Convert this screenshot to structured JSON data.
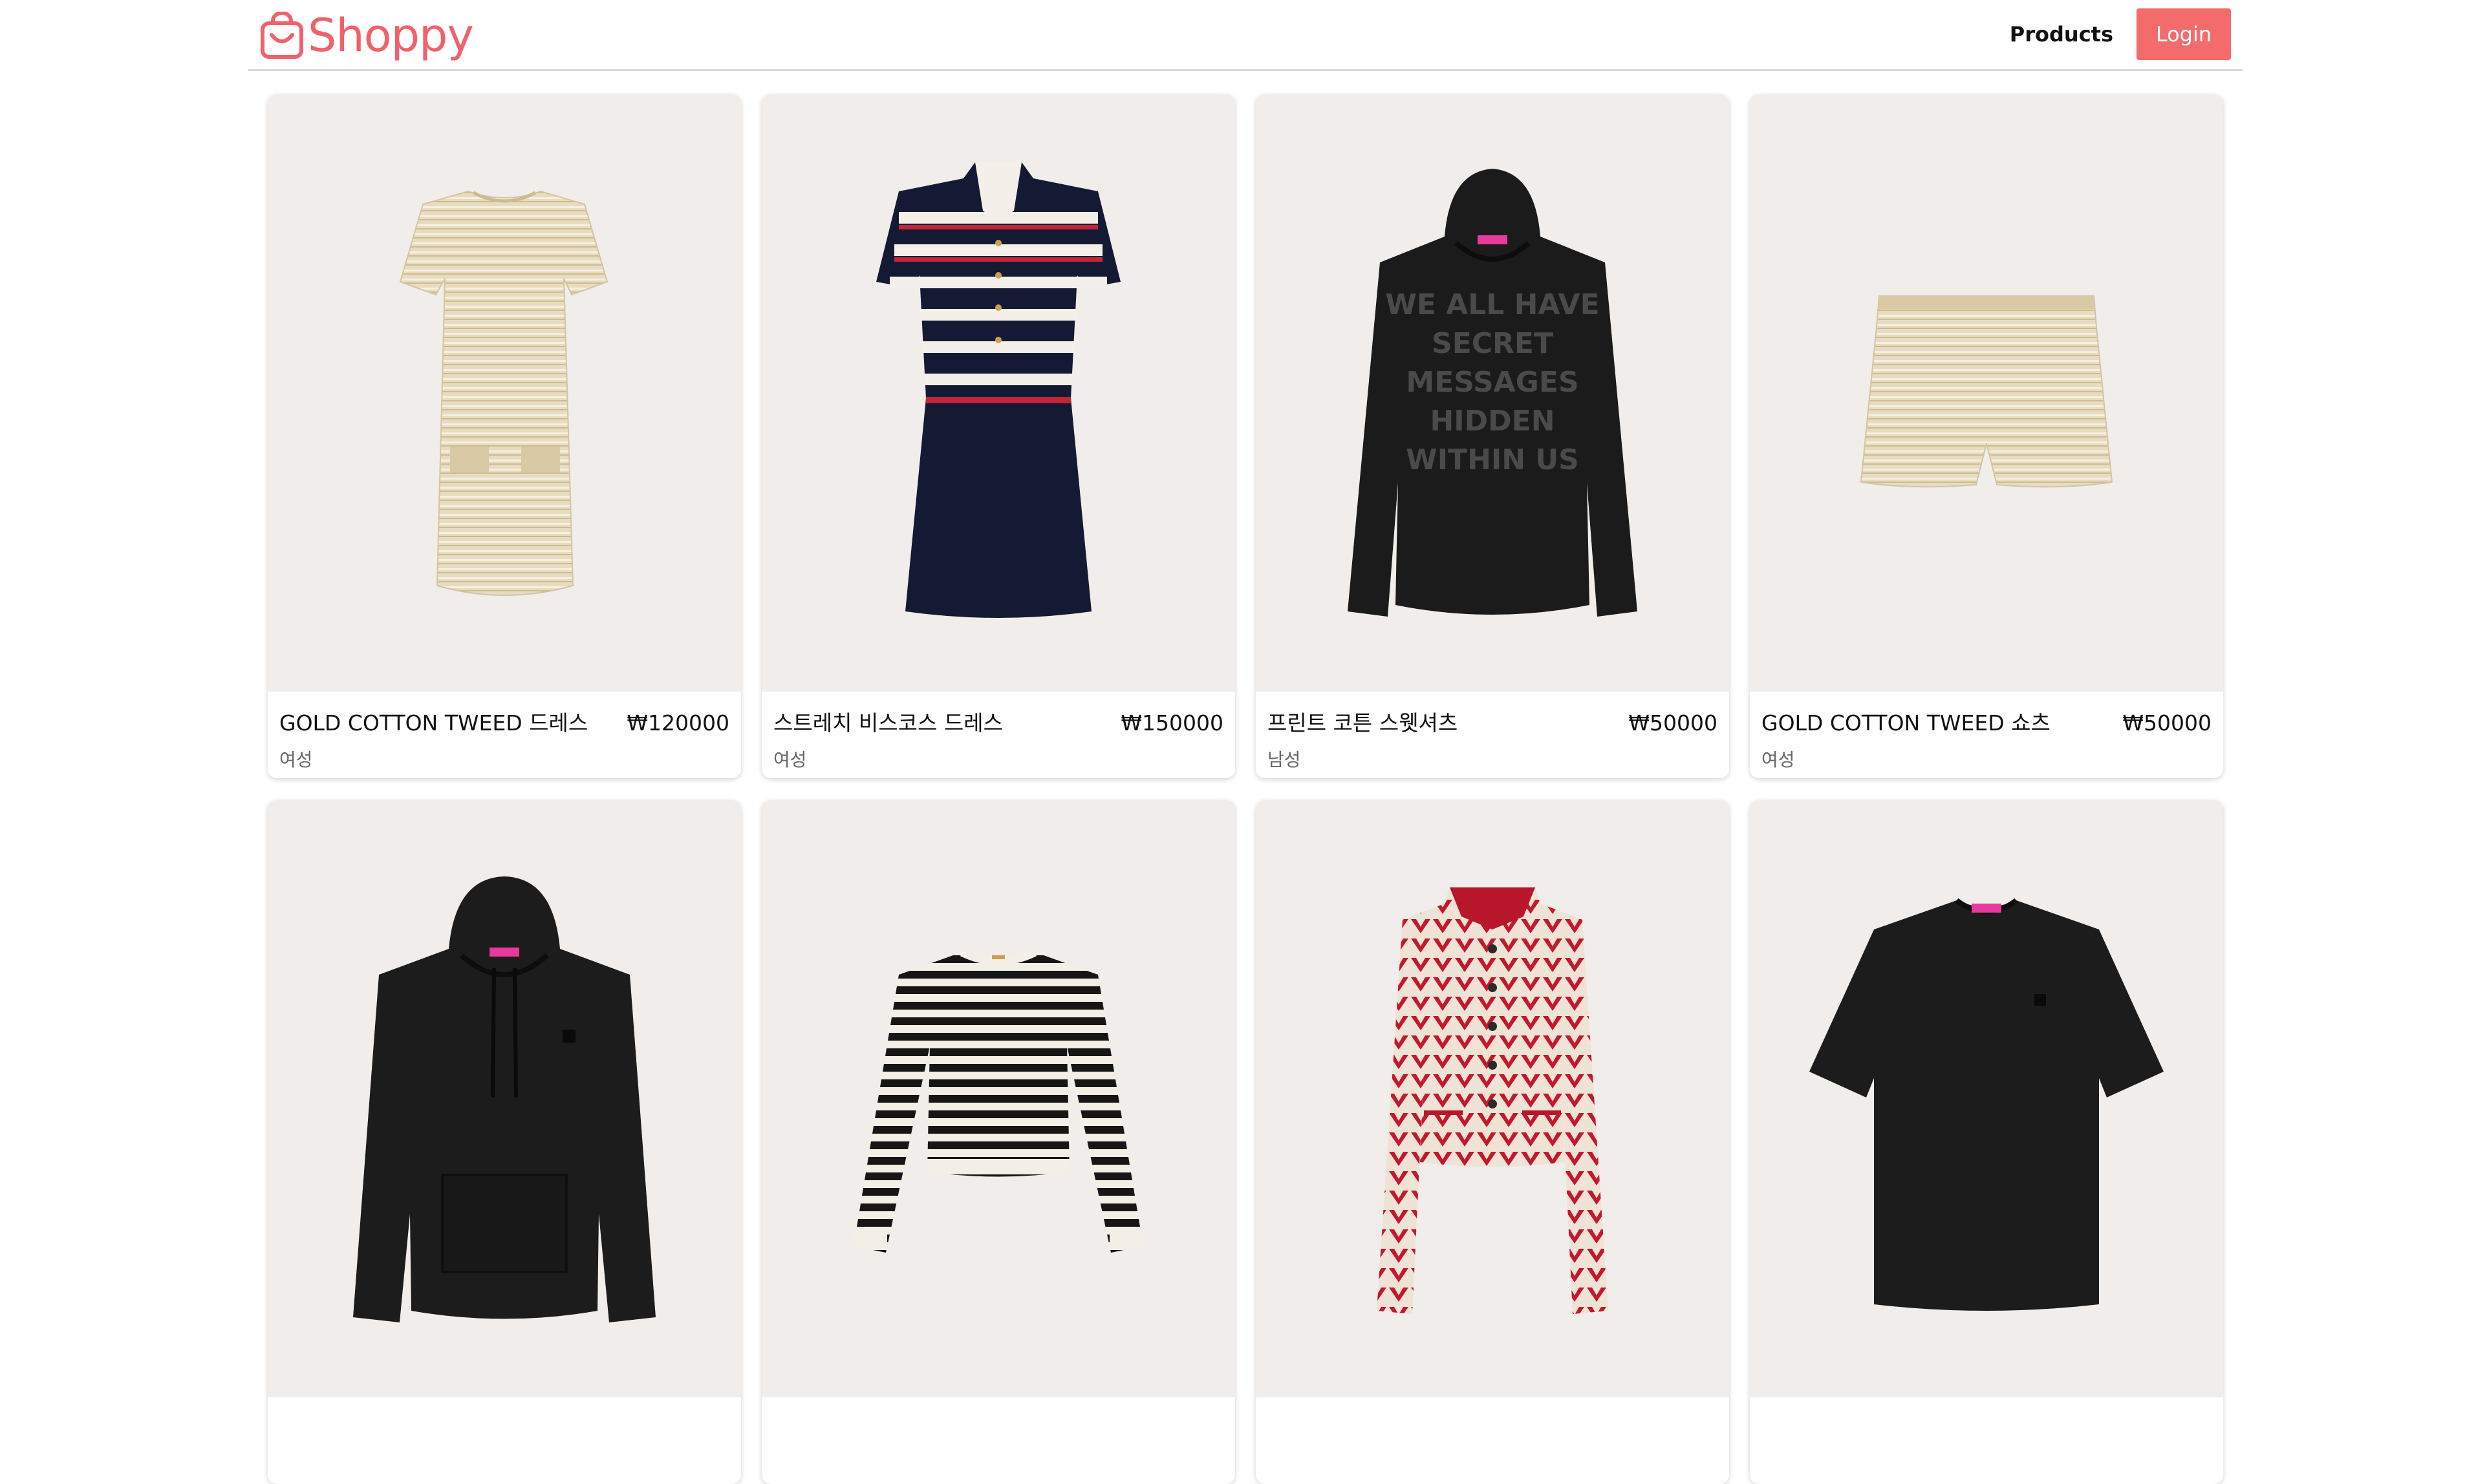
{
  "header": {
    "brand": "Shoppy",
    "nav_products": "Products",
    "login_label": "Login",
    "accent_color": "#f36b6b",
    "logo_icon": "shopping-bag-icon"
  },
  "products": [
    {
      "title": "GOLD COTTON TWEED 드레스",
      "price": "₩120000",
      "category": "여성"
    },
    {
      "title": "스트레치 비스코스 드레스",
      "price": "₩150000",
      "category": "여성"
    },
    {
      "title": "프린트 코튼 스웻셔츠",
      "price": "₩50000",
      "category": "남성"
    },
    {
      "title": "GOLD COTTON TWEED 쇼츠",
      "price": "₩50000",
      "category": "여성"
    },
    {
      "title": "",
      "price": "",
      "category": ""
    },
    {
      "title": "",
      "price": "",
      "category": ""
    },
    {
      "title": "",
      "price": "",
      "category": ""
    },
    {
      "title": "",
      "price": "",
      "category": ""
    }
  ],
  "product_images": [
    "tweed-dress-image",
    "striped-knit-dress-image",
    "black-print-hoodie-image",
    "tweed-shorts-image",
    "black-hoodie-image",
    "striped-sweater-image",
    "red-pattern-jacket-image",
    "black-tshirt-image"
  ]
}
